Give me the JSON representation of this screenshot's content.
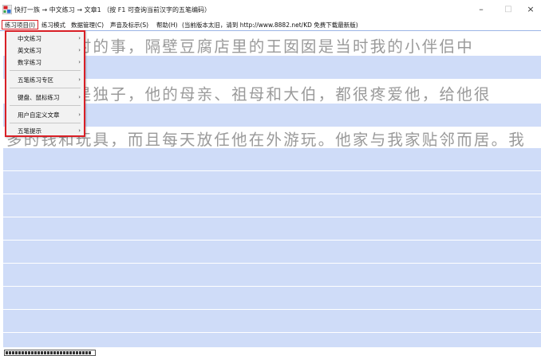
{
  "window": {
    "title": "快打一族 → 中文练习 → 文章1  （按 F1 可查询当前汉字的五笔编码）",
    "minimize": "–",
    "maximize": "□",
    "close": "×",
    "icon": "app-icon"
  },
  "menubar": {
    "items": [
      {
        "label": "练习项目(I)"
      },
      {
        "label": "练习模式"
      },
      {
        "label": "数据管理(C)"
      },
      {
        "label": "声音及标示(S)"
      },
      {
        "label": "帮助(H)"
      },
      {
        "label": "(当前版本太旧，请到 http://www.8882.net/KD 免费下载最新版)"
      }
    ]
  },
  "dropdown": {
    "items": [
      {
        "label": "中文练习",
        "arrow": "›"
      },
      {
        "label": "英文练习",
        "arrow": "›"
      },
      {
        "label": "数字练习",
        "arrow": "›"
      },
      {
        "label": "五笔练习专区",
        "arrow": "›"
      },
      {
        "label": "键盘、鼠标练习",
        "arrow": "›"
      },
      {
        "label": "用户自定义文章",
        "arrow": "›"
      },
      {
        "label": "五笔提示",
        "arrow": "›"
      }
    ]
  },
  "practice": {
    "lines": [
      "那是三岁时的事，隔壁豆腐店里的王囡囡是当时我的小伴侣中",
      "之一。他是独子，他的母亲、祖母和大伯，都很疼爱他，给他很",
      "多的钱和玩具，而且每天放任他在外游玩。他家与我家贴邻而居。我"
    ]
  },
  "status": {
    "progress_fraction": 0.96
  }
}
